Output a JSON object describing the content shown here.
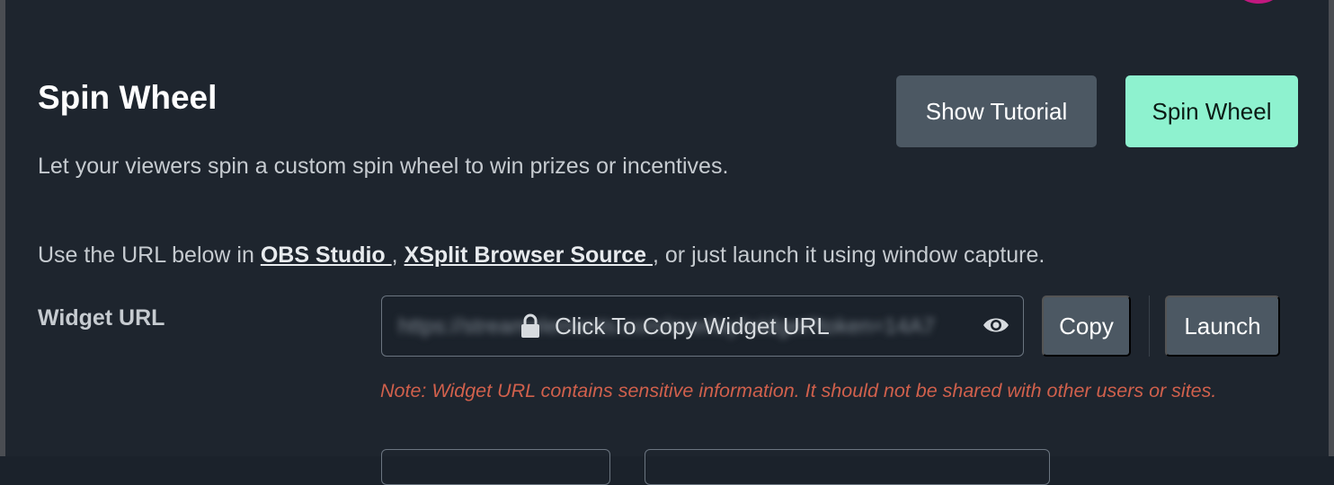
{
  "page": {
    "title": "Spin Wheel",
    "description": "Let your viewers spin a custom spin wheel to win prizes or incentives."
  },
  "header_buttons": {
    "tutorial_label": "Show Tutorial",
    "spin_label": "Spin Wheel"
  },
  "url_help": {
    "prefix": "Use the URL below in ",
    "link_obs": "OBS Studio ",
    "sep": ", ",
    "link_xsplit": "XSplit Browser Source ",
    "suffix": ", or just launch it using window capture."
  },
  "widget_url": {
    "label": "Widget URL",
    "overlay_text": "Click To Copy Widget URL",
    "blurred_value": "https://streamelements.com/overlay/widget?token=14A7",
    "copy_label": "Copy",
    "launch_label": "Launch",
    "note": "Note: Widget URL contains sensitive information. It should not be shared with other users or sites."
  },
  "icons": {
    "lock": "lock-icon",
    "eye": "eye-icon"
  },
  "colors": {
    "background": "#1e252e",
    "accent_button": "#8ef2cf",
    "secondary_button": "#4c5863",
    "warning_text": "#d0604c"
  }
}
